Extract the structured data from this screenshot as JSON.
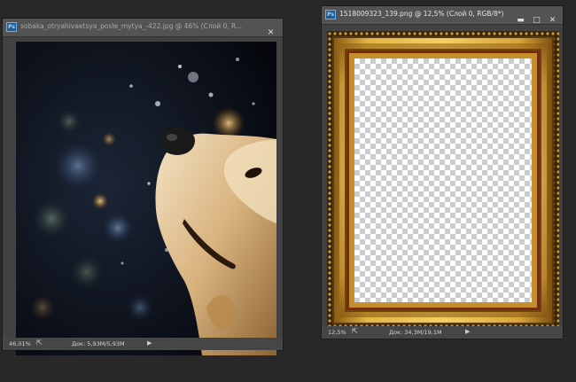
{
  "doc1": {
    "title": "sobaka_otryahivaetsya_posle_mytya_-422.jpg @ 46% (Слой 0, R...",
    "zoom": "46,01%",
    "doc_size": "Док: 5,93M/5,93M"
  },
  "doc2": {
    "title": "1518009323_139.png @ 12,5% (Слой 0, RGB/8*)",
    "zoom": "12,5%",
    "doc_size": "Док: 34,3M/19,1M"
  },
  "window_controls": {
    "minimize": "▬",
    "maximize": "□",
    "close": "✕"
  },
  "status_icons": {
    "export": "⇱",
    "menu": "▶"
  },
  "app_badge": "Ps",
  "colors": {
    "workspace": "#282828",
    "frame_gold": "#d3a43a",
    "frame_dark": "#3b2508",
    "frame_red": "#7a2a14"
  }
}
